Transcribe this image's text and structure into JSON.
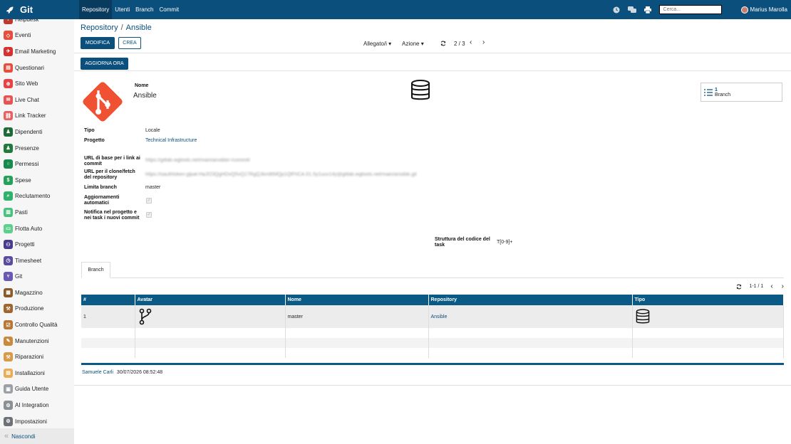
{
  "app": {
    "name": "Git"
  },
  "topnav": {
    "items": [
      "Repository",
      "Utenti",
      "Branch",
      "Commit"
    ],
    "search_placeholder": "Cerca...",
    "user": "Marius Marolla"
  },
  "sidebar": {
    "items": [
      {
        "label": "Helpdesk",
        "color": "#c0392b",
        "glyph": "?"
      },
      {
        "label": "Eventi",
        "color": "#e74c3c",
        "glyph": "◇"
      },
      {
        "label": "Email Marketing",
        "color": "#d63031",
        "glyph": "✈"
      },
      {
        "label": "Questionari",
        "color": "#e74c3c",
        "glyph": "▤"
      },
      {
        "label": "Sito Web",
        "color": "#e84343",
        "glyph": "⊕"
      },
      {
        "label": "Live Chat",
        "color": "#e55353",
        "glyph": "✉"
      },
      {
        "label": "Link Tracker",
        "color": "#e86060",
        "glyph": "⛓"
      },
      {
        "label": "Dipendenti",
        "color": "#1e6b3a",
        "glyph": "♟"
      },
      {
        "label": "Presenze",
        "color": "#1f7a3c",
        "glyph": "♟"
      },
      {
        "label": "Permessi",
        "color": "#198a4d",
        "glyph": "○"
      },
      {
        "label": "Spese",
        "color": "#27a05a",
        "glyph": "$"
      },
      {
        "label": "Reclutamento",
        "color": "#2fb36a",
        "glyph": "⌕"
      },
      {
        "label": "Pasti",
        "color": "#48c27c",
        "glyph": "▥"
      },
      {
        "label": "Flotta Auto",
        "color": "#5fcf8e",
        "glyph": "▭"
      },
      {
        "label": "Progetti",
        "color": "#4a3c8c",
        "glyph": "⚇"
      },
      {
        "label": "Timesheet",
        "color": "#5a4aa0",
        "glyph": "◷"
      },
      {
        "label": "Git",
        "color": "#6a58b3",
        "glyph": "⑂"
      },
      {
        "label": "Magazzino",
        "color": "#8a5a2b",
        "glyph": "▦"
      },
      {
        "label": "Produzione",
        "color": "#a0652e",
        "glyph": "⚒"
      },
      {
        "label": "Controllo Qualità",
        "color": "#b87633",
        "glyph": "☑"
      },
      {
        "label": "Manutenzioni",
        "color": "#c98a3d",
        "glyph": "✎"
      },
      {
        "label": "Riparazioni",
        "color": "#d99a48",
        "glyph": "⚒"
      },
      {
        "label": "Installazioni",
        "color": "#e8ac55",
        "glyph": "▤"
      },
      {
        "label": "Guida Utente",
        "color": "#9aa0a6",
        "glyph": "▣"
      },
      {
        "label": "AI Integration",
        "color": "#8a9096",
        "glyph": "⚙"
      },
      {
        "label": "Impostazioni",
        "color": "#6c7278",
        "glyph": "⚙"
      }
    ],
    "hide_label": "Nascondi"
  },
  "breadcrumb": {
    "parent": "Repository",
    "current": "Ansible"
  },
  "toolbar": {
    "edit": "MODIFICA",
    "create": "CREA",
    "attachments": "Allegato/i",
    "action": "Azione",
    "pager": "2 / 3"
  },
  "status": {
    "update_button": "AGGIORNA ORA"
  },
  "record": {
    "name_label": "Nome",
    "name": "Ansible",
    "stat": {
      "count": "1",
      "label": "Branch"
    },
    "fields": {
      "tipo_label": "Tipo",
      "tipo": "Locale",
      "progetto_label": "Progetto",
      "progetto": "Technical Infrastructure",
      "url_base_label": "URL di base per i link ai commit",
      "url_base": "https://gitlab.wgtools.net/main/ansible/-/commit/",
      "url_clone_label": "URL per il clone/fetch del repository",
      "url_clone": "https://oauthtoken:glpat-HaJf23QgHDvQ5vQ17RgQJkm8tMQp1QlFhCA.01.0y1uuv14y@gitlab.wgtools.net/main/ansible.git",
      "limit_label": "Limita branch",
      "limit": "master",
      "auto_label": "Aggiornamenti automatici",
      "notify_label": "Notifica nel progetto e nei task i nuovi commit",
      "code_label": "Struttura del codice del task",
      "code": "T[0-9]+"
    }
  },
  "tabs": {
    "branch": "Branch"
  },
  "list": {
    "pager": "1-1 / 1",
    "headers": [
      "#",
      "Avatar",
      "Nome",
      "Repository",
      "Tipo"
    ],
    "rows": [
      {
        "num": "1",
        "name": "master",
        "repository": "Ansible"
      }
    ]
  },
  "footer": {
    "author": "Samuele Carli",
    "date": "30/07/2026 08:52:48"
  }
}
